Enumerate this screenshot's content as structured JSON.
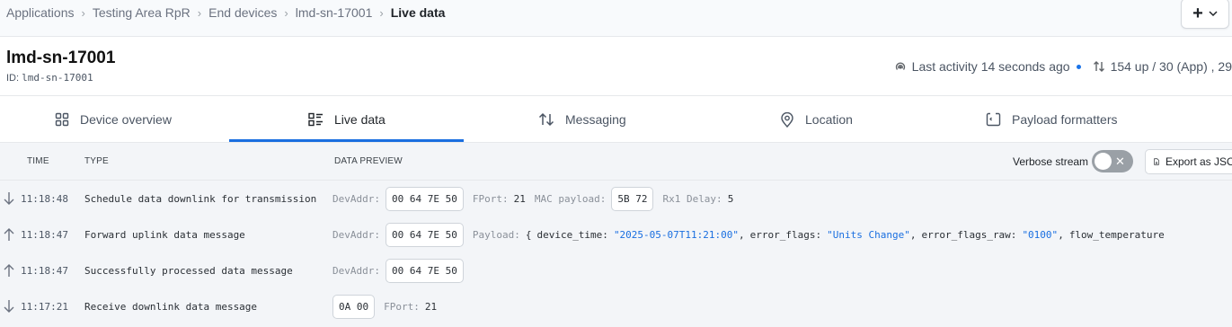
{
  "breadcrumb": {
    "items": [
      "Applications",
      "Testing Area RpR",
      "End devices",
      "lmd-sn-17001"
    ],
    "current": "Live data"
  },
  "header_actions": {
    "add_label": "+"
  },
  "device": {
    "name": "lmd-sn-17001",
    "id_label": "ID:",
    "id_value": "lmd-sn-17001",
    "last_activity": "Last activity 14 seconds ago",
    "traffic": "154 up / 30 (App) , 29"
  },
  "tabs": [
    {
      "label": "Device overview",
      "icon": "grid-icon"
    },
    {
      "label": "Live data",
      "icon": "list-icon",
      "active": true
    },
    {
      "label": "Messaging",
      "icon": "arrows-up-down-icon"
    },
    {
      "label": "Location",
      "icon": "pin-icon"
    },
    {
      "label": "Payload formatters",
      "icon": "code-icon"
    }
  ],
  "table": {
    "headers": {
      "time": "TIME",
      "type": "TYPE",
      "preview": "DATA PREVIEW"
    },
    "verbose_label": "Verbose stream",
    "verbose_on": false,
    "export_label": "Export as JSON",
    "rows": [
      {
        "direction": "down",
        "time": "11:18:48",
        "type": "Schedule data downlink for transmission",
        "devaddr_label": "DevAddr:",
        "devaddr": "00 64 7E 50",
        "fport_label": "FPort:",
        "fport": "21",
        "mac_label": "MAC payload:",
        "mac": "5B 72",
        "rx1_label": "Rx1 Delay:",
        "rx1": "5"
      },
      {
        "direction": "up",
        "time": "11:18:47",
        "type": "Forward uplink data message",
        "devaddr_label": "DevAddr:",
        "devaddr": "00 64 7E 50",
        "payload_label": "Payload:",
        "open_brace": "{",
        "f1_key": "device_time:",
        "f1_val": "\"2025-05-07T11:21:00\"",
        "f2_key": "error_flags:",
        "f2_val": "\"Units Change\"",
        "f3_key": "error_flags_raw:",
        "f3_val": "\"0100\"",
        "f4_key": "flow_temperature"
      },
      {
        "direction": "up",
        "time": "11:18:47",
        "type": "Successfully processed data message",
        "devaddr_label": "DevAddr:",
        "devaddr": "00 64 7E 50"
      },
      {
        "direction": "down",
        "time": "11:17:21",
        "type": "Receive downlink data message",
        "raw": "0A 00",
        "fport_label": "FPort:",
        "fport": "21"
      }
    ]
  }
}
